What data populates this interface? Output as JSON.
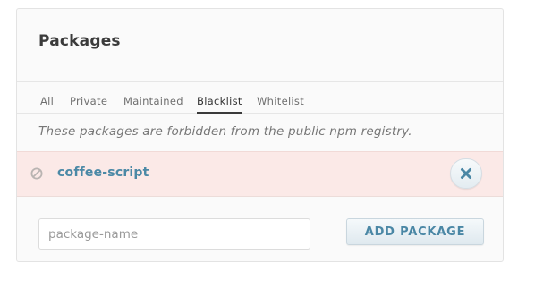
{
  "panel": {
    "title": "Packages"
  },
  "tabs": [
    {
      "label": "All",
      "active": false
    },
    {
      "label": "Private",
      "active": false
    },
    {
      "label": "Maintained",
      "active": false
    },
    {
      "label": "Blacklist",
      "active": true
    },
    {
      "label": "Whitelist",
      "active": false
    }
  ],
  "description": "These packages are forbidden from the public npm registry.",
  "packages": [
    {
      "name": "coffee-script",
      "status_icon": "ban-icon",
      "action_icon": "close-icon"
    }
  ],
  "add_form": {
    "input_value": "",
    "input_placeholder": "package-name",
    "button_label": "ADD PACKAGE"
  },
  "colors": {
    "accent": "#4b89a6",
    "row_background": "#fbe9e7",
    "panel_background": "#fafafa"
  }
}
